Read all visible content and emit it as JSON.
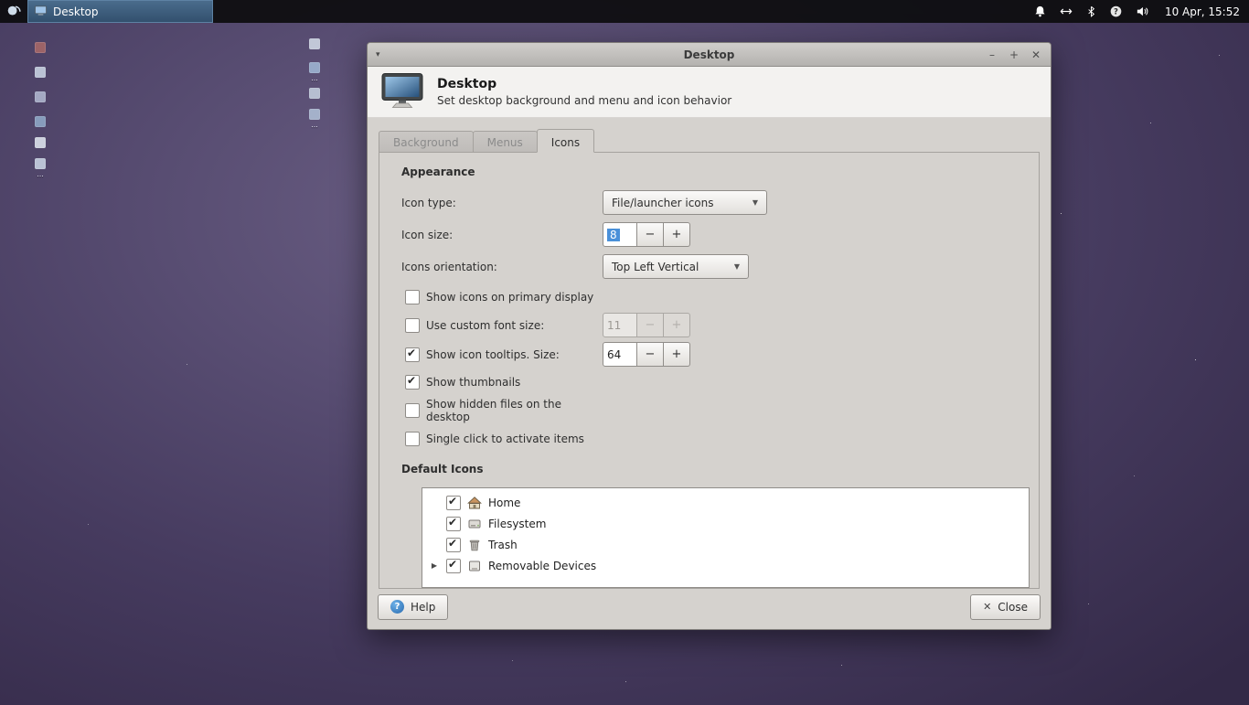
{
  "panel": {
    "taskbar_label": "Desktop",
    "clock": "10 Apr, 15:52",
    "tray_icons": [
      "notifications-icon",
      "network-icon",
      "bluetooth-icon",
      "help-icon",
      "volume-icon"
    ]
  },
  "desktop": {
    "icons": [
      {
        "label": ""
      },
      {
        "label": ""
      },
      {
        "label": ""
      },
      {
        "label": ""
      },
      {
        "label": ""
      },
      {
        "label": "..."
      },
      {
        "label": ""
      },
      {
        "label": "..."
      },
      {
        "label": ""
      },
      {
        "label": "..."
      }
    ]
  },
  "glyphs": {
    "menu_caret": "▾",
    "minimize": "–",
    "maximize": "+",
    "close": "✕",
    "dropdown_arrow": "▼",
    "minus": "−",
    "plus": "+",
    "expander": "▶",
    "help_qmark": "?",
    "close_x": "✕"
  },
  "window": {
    "title": "Desktop",
    "header": {
      "title": "Desktop",
      "subtitle": "Set desktop background and menu and icon behavior"
    },
    "tabs": [
      {
        "label": "Background",
        "active": false
      },
      {
        "label": "Menus",
        "active": false
      },
      {
        "label": "Icons",
        "active": true
      }
    ],
    "appearance": {
      "section_title": "Appearance",
      "icon_type_label": "Icon type:",
      "icon_type_value": "File/launcher icons",
      "icon_size_label": "Icon size:",
      "icon_size_value": "8",
      "orientation_label": "Icons orientation:",
      "orientation_value": "Top Left Vertical",
      "options": [
        {
          "label": "Show icons on primary display",
          "checked": false
        },
        {
          "label": "Use custom font size:",
          "checked": false,
          "spin_value": "11",
          "spin_enabled": false
        },
        {
          "label": "Show icon tooltips. Size:",
          "checked": true,
          "spin_value": "64",
          "spin_enabled": true
        },
        {
          "label": "Show thumbnails",
          "checked": true
        },
        {
          "label": "Show hidden files on the desktop",
          "checked": false
        },
        {
          "label": "Single click to activate items",
          "checked": false
        }
      ]
    },
    "default_icons": {
      "section_title": "Default Icons",
      "items": [
        {
          "label": "Home",
          "checked": true
        },
        {
          "label": "Filesystem",
          "checked": true
        },
        {
          "label": "Trash",
          "checked": true
        },
        {
          "label": "Removable Devices",
          "checked": true,
          "expandable": true
        }
      ]
    },
    "footer": {
      "help_label": "Help",
      "close_label": "Close"
    },
    "accent_color": "#4a90d9"
  }
}
